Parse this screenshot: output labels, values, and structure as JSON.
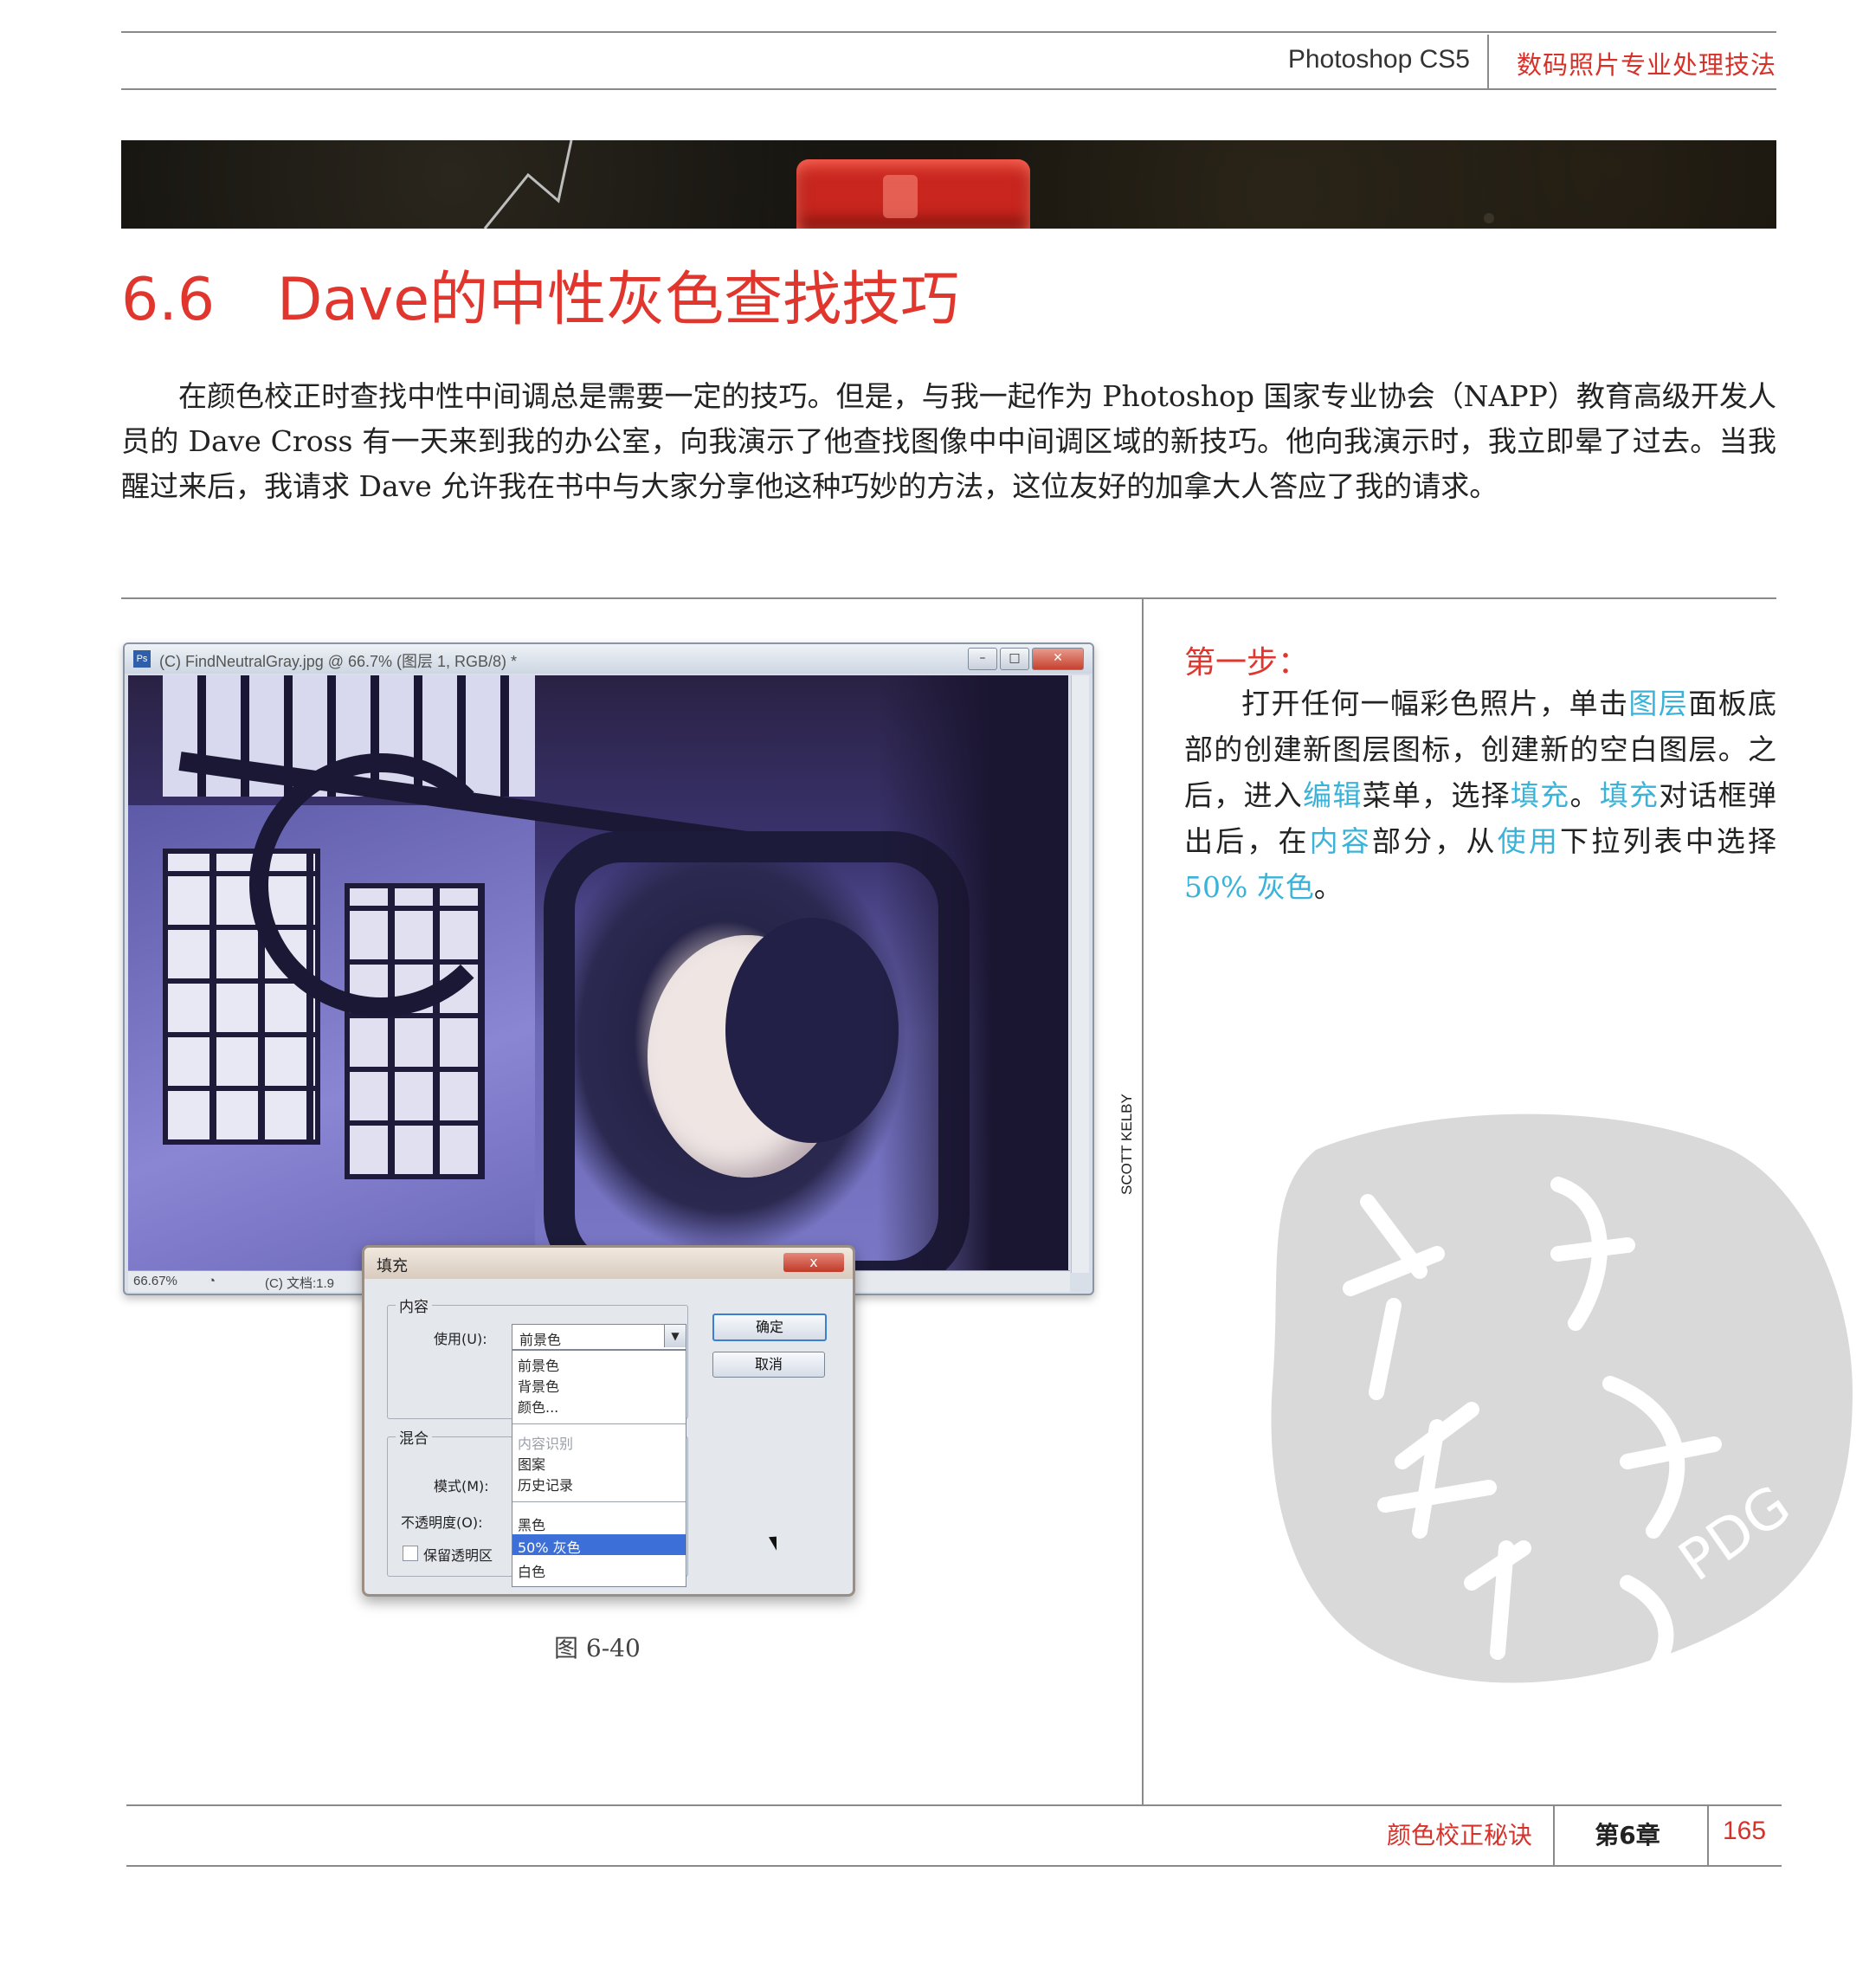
{
  "header": {
    "product": "Photoshop CS5",
    "book_title": "数码照片专业处理技法"
  },
  "section": {
    "number": "6.6",
    "title": "Dave的中性灰色查找技巧"
  },
  "intro": "在颜色校正时查找中性中间调总是需要一定的技巧。但是，与我一起作为 Photoshop 国家专业协会（NAPP）教育高级开发人员的 Dave Cross 有一天来到我的办公室，向我演示了他查找图像中中间调区域的新技巧。他向我演示时，我立即晕了过去。当我醒过来后，我请求 Dave 允许我在书中与大家分享他这种巧妙的方法，这位友好的加拿大人答应了我的请求。",
  "figure": {
    "window_title": "(C) FindNeutralGray.jpg @ 66.7% (图层 1, RGB/8) *",
    "status_zoom": "66.67%",
    "status_doc": "(C) 文档:1.9",
    "caption": "图 6-40",
    "credit": "SCOTT KELBY",
    "dialog": {
      "title": "填充",
      "close": "x",
      "contents_legend": "内容",
      "use_label": "使用(U):",
      "use_value": "前景色",
      "blend_legend": "混合",
      "mode_label": "模式(M):",
      "opacity_label": "不透明度(O):",
      "preserve_label": "保留透明区",
      "ok_label": "确定",
      "cancel_label": "取消",
      "options": [
        "前景色",
        "背景色",
        "颜色...",
        "内容识别",
        "图案",
        "历史记录",
        "黑色",
        "50% 灰色",
        "白色"
      ]
    }
  },
  "step": {
    "heading": "第一步：",
    "parts": [
      "打开任何一幅彩色照片，单击",
      "图层",
      "面板底部的创建新图层图标，创建新的空白图层。之后，进入",
      "编辑",
      "菜单，选择",
      "填充",
      "。",
      "填充",
      "对话框弹出后，在",
      "内容",
      "部分，从",
      "使用",
      "下拉列表中选择 ",
      "50% 灰色",
      "。"
    ]
  },
  "watermark": {
    "text": "PDG"
  },
  "footer": {
    "section": "颜色校正秘诀",
    "chapter": "第6章",
    "page": "165"
  },
  "colors": {
    "accent_red": "#e0362d",
    "highlight_blue": "#3bb3d8",
    "rule_gray": "#8a8a8a"
  }
}
